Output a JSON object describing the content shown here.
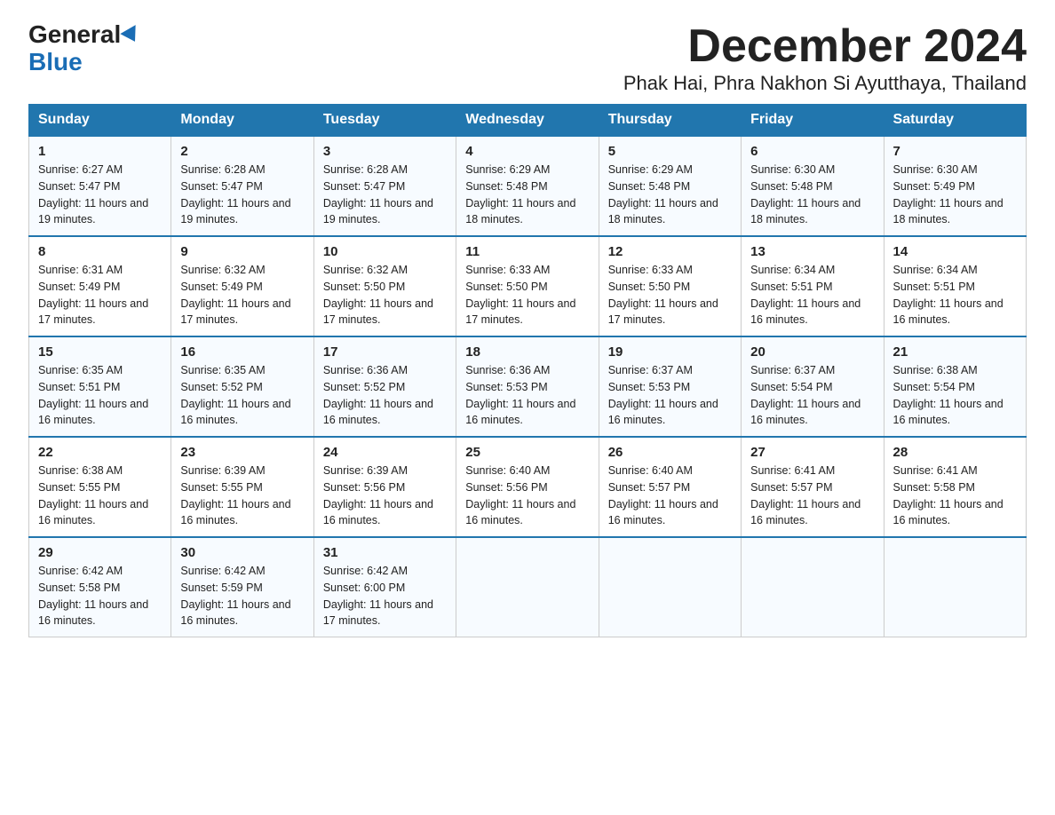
{
  "logo": {
    "general": "General",
    "blue": "Blue"
  },
  "title": "December 2024",
  "location": "Phak Hai, Phra Nakhon Si Ayutthaya, Thailand",
  "days_of_week": [
    "Sunday",
    "Monday",
    "Tuesday",
    "Wednesday",
    "Thursday",
    "Friday",
    "Saturday"
  ],
  "weeks": [
    [
      {
        "day": "1",
        "sunrise": "6:27 AM",
        "sunset": "5:47 PM",
        "daylight": "11 hours and 19 minutes."
      },
      {
        "day": "2",
        "sunrise": "6:28 AM",
        "sunset": "5:47 PM",
        "daylight": "11 hours and 19 minutes."
      },
      {
        "day": "3",
        "sunrise": "6:28 AM",
        "sunset": "5:47 PM",
        "daylight": "11 hours and 19 minutes."
      },
      {
        "day": "4",
        "sunrise": "6:29 AM",
        "sunset": "5:48 PM",
        "daylight": "11 hours and 18 minutes."
      },
      {
        "day": "5",
        "sunrise": "6:29 AM",
        "sunset": "5:48 PM",
        "daylight": "11 hours and 18 minutes."
      },
      {
        "day": "6",
        "sunrise": "6:30 AM",
        "sunset": "5:48 PM",
        "daylight": "11 hours and 18 minutes."
      },
      {
        "day": "7",
        "sunrise": "6:30 AM",
        "sunset": "5:49 PM",
        "daylight": "11 hours and 18 minutes."
      }
    ],
    [
      {
        "day": "8",
        "sunrise": "6:31 AM",
        "sunset": "5:49 PM",
        "daylight": "11 hours and 17 minutes."
      },
      {
        "day": "9",
        "sunrise": "6:32 AM",
        "sunset": "5:49 PM",
        "daylight": "11 hours and 17 minutes."
      },
      {
        "day": "10",
        "sunrise": "6:32 AM",
        "sunset": "5:50 PM",
        "daylight": "11 hours and 17 minutes."
      },
      {
        "day": "11",
        "sunrise": "6:33 AM",
        "sunset": "5:50 PM",
        "daylight": "11 hours and 17 minutes."
      },
      {
        "day": "12",
        "sunrise": "6:33 AM",
        "sunset": "5:50 PM",
        "daylight": "11 hours and 17 minutes."
      },
      {
        "day": "13",
        "sunrise": "6:34 AM",
        "sunset": "5:51 PM",
        "daylight": "11 hours and 16 minutes."
      },
      {
        "day": "14",
        "sunrise": "6:34 AM",
        "sunset": "5:51 PM",
        "daylight": "11 hours and 16 minutes."
      }
    ],
    [
      {
        "day": "15",
        "sunrise": "6:35 AM",
        "sunset": "5:51 PM",
        "daylight": "11 hours and 16 minutes."
      },
      {
        "day": "16",
        "sunrise": "6:35 AM",
        "sunset": "5:52 PM",
        "daylight": "11 hours and 16 minutes."
      },
      {
        "day": "17",
        "sunrise": "6:36 AM",
        "sunset": "5:52 PM",
        "daylight": "11 hours and 16 minutes."
      },
      {
        "day": "18",
        "sunrise": "6:36 AM",
        "sunset": "5:53 PM",
        "daylight": "11 hours and 16 minutes."
      },
      {
        "day": "19",
        "sunrise": "6:37 AM",
        "sunset": "5:53 PM",
        "daylight": "11 hours and 16 minutes."
      },
      {
        "day": "20",
        "sunrise": "6:37 AM",
        "sunset": "5:54 PM",
        "daylight": "11 hours and 16 minutes."
      },
      {
        "day": "21",
        "sunrise": "6:38 AM",
        "sunset": "5:54 PM",
        "daylight": "11 hours and 16 minutes."
      }
    ],
    [
      {
        "day": "22",
        "sunrise": "6:38 AM",
        "sunset": "5:55 PM",
        "daylight": "11 hours and 16 minutes."
      },
      {
        "day": "23",
        "sunrise": "6:39 AM",
        "sunset": "5:55 PM",
        "daylight": "11 hours and 16 minutes."
      },
      {
        "day": "24",
        "sunrise": "6:39 AM",
        "sunset": "5:56 PM",
        "daylight": "11 hours and 16 minutes."
      },
      {
        "day": "25",
        "sunrise": "6:40 AM",
        "sunset": "5:56 PM",
        "daylight": "11 hours and 16 minutes."
      },
      {
        "day": "26",
        "sunrise": "6:40 AM",
        "sunset": "5:57 PM",
        "daylight": "11 hours and 16 minutes."
      },
      {
        "day": "27",
        "sunrise": "6:41 AM",
        "sunset": "5:57 PM",
        "daylight": "11 hours and 16 minutes."
      },
      {
        "day": "28",
        "sunrise": "6:41 AM",
        "sunset": "5:58 PM",
        "daylight": "11 hours and 16 minutes."
      }
    ],
    [
      {
        "day": "29",
        "sunrise": "6:42 AM",
        "sunset": "5:58 PM",
        "daylight": "11 hours and 16 minutes."
      },
      {
        "day": "30",
        "sunrise": "6:42 AM",
        "sunset": "5:59 PM",
        "daylight": "11 hours and 16 minutes."
      },
      {
        "day": "31",
        "sunrise": "6:42 AM",
        "sunset": "6:00 PM",
        "daylight": "11 hours and 17 minutes."
      },
      null,
      null,
      null,
      null
    ]
  ]
}
